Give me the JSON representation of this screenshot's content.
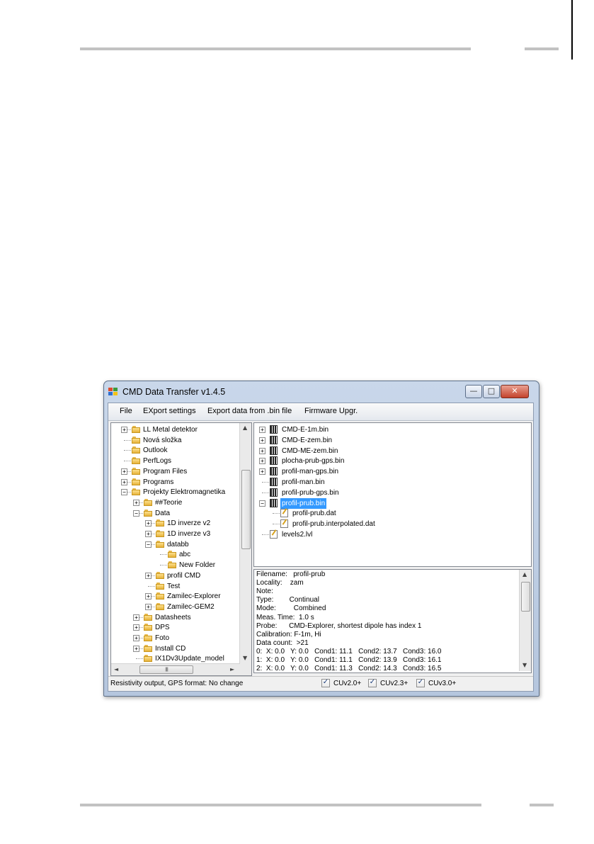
{
  "window": {
    "title": "CMD Data Transfer v1.4.5",
    "minimize_glyph": "—",
    "maximize_glyph": "□",
    "close_glyph": "✕"
  },
  "menu": [
    "File",
    "EXport settings",
    "Export data from .bin file",
    "Firmware Upgr."
  ],
  "folder_tree": {
    "items": [
      {
        "label": "LL Metal detektor",
        "expander": "+"
      },
      {
        "label": "Nová složka",
        "expander": ""
      },
      {
        "label": "Outlook",
        "expander": ""
      },
      {
        "label": "PerfLogs",
        "expander": ""
      },
      {
        "label": "Program Files",
        "expander": "+"
      },
      {
        "label": "Programs",
        "expander": "+"
      },
      {
        "label": "Projekty Elektromagnetika",
        "expander": "−"
      },
      {
        "label": "##Teorie",
        "expander": "+"
      },
      {
        "label": "Data",
        "expander": "−"
      },
      {
        "label": "1D inverze v2",
        "expander": "+"
      },
      {
        "label": "1D inverze v3",
        "expander": "+"
      },
      {
        "label": "databb",
        "expander": "−"
      },
      {
        "label": "abc",
        "expander": ""
      },
      {
        "label": "New Folder",
        "expander": ""
      },
      {
        "label": "profil CMD",
        "expander": "+"
      },
      {
        "label": "Test",
        "expander": ""
      },
      {
        "label": "Zamilec-Explorer",
        "expander": "+"
      },
      {
        "label": "Zamilec-GEM2",
        "expander": "+"
      },
      {
        "label": "Datasheets",
        "expander": "+"
      },
      {
        "label": "DPS",
        "expander": "+"
      },
      {
        "label": "Foto",
        "expander": "+"
      },
      {
        "label": "Install CD",
        "expander": "+"
      },
      {
        "label": "IX1Dv3Update_model",
        "expander": ""
      }
    ],
    "scroll_up": "▲",
    "scroll_down": "▼",
    "scroll_left": "◄",
    "scroll_right": "►",
    "grip": "III"
  },
  "file_tree": {
    "items": [
      {
        "label": "CMD-E-1m.bin",
        "expander": "+"
      },
      {
        "label": "CMD-E-zem.bin",
        "expander": "+"
      },
      {
        "label": "CMD-ME-zem.bin",
        "expander": "+"
      },
      {
        "label": "plocha-prub-gps.bin",
        "expander": "+"
      },
      {
        "label": "profil-man-gps.bin",
        "expander": "+"
      },
      {
        "label": "profil-man.bin",
        "expander": ""
      },
      {
        "label": "profil-prub-gps.bin",
        "expander": ""
      },
      {
        "label": "profil-prub.bin",
        "expander": "−",
        "selected": true
      },
      {
        "label": "profil-prub.dat",
        "expander": ""
      },
      {
        "label": "profil-prub.interpolated.dat",
        "expander": ""
      },
      {
        "label": "levels2.lvl",
        "expander": ""
      }
    ]
  },
  "info": {
    "lines": [
      "Filename:   profil-prub",
      "Locality:    zam",
      "Note:",
      "Type:        Continual",
      "Mode:         Combined",
      "Meas. Time:  1.0 s",
      "Probe:      CMD-Explorer, shortest dipole has index 1",
      "Calibration: F-1m, Hi",
      "Data count:  >21",
      "0:  X: 0.0   Y: 0.0   Cond1: 11.1   Cond2: 13.7   Cond3: 16.0",
      "1:  X: 0.0   Y: 0.0   Cond1: 11.1   Cond2: 13.9   Cond3: 16.1",
      "2:  X: 0.0   Y: 0.0   Cond1: 11.3   Cond2: 14.3   Cond3: 16.5"
    ]
  },
  "status": {
    "text": "Resistivity output, GPS format: No change",
    "checkboxes": [
      {
        "label": "CUv2.0+",
        "checked": true
      },
      {
        "label": "CUv2.3+",
        "checked": true
      },
      {
        "label": "CUv3.0+",
        "checked": true
      }
    ],
    "check_glyph": "✓"
  }
}
